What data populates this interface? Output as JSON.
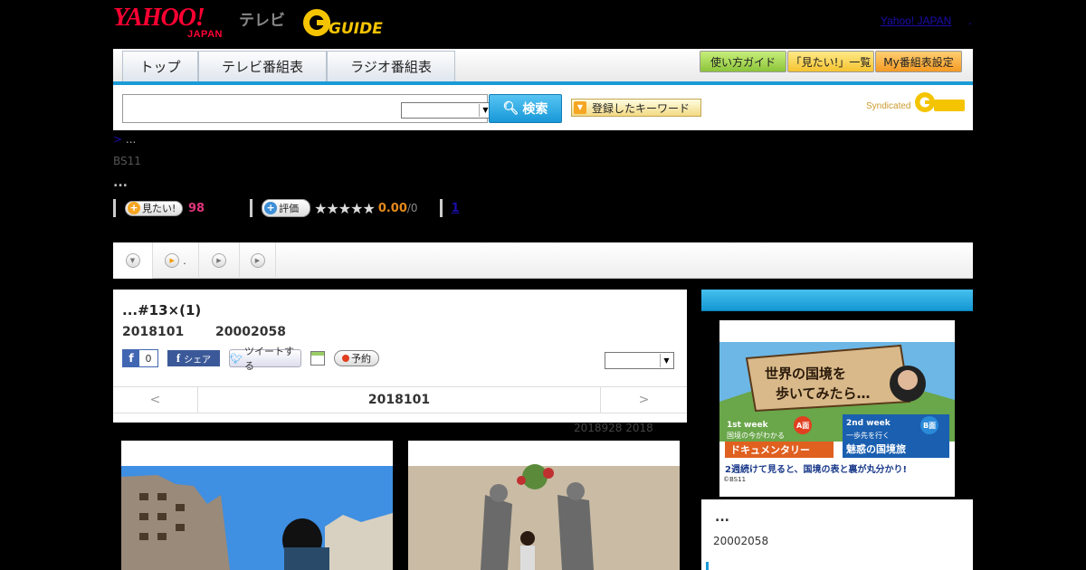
{
  "header": {
    "logo_yahoo_text": "YAHOO!",
    "logo_japan_text": "JAPAN",
    "logo_tv_text": "テレビ",
    "logo_gguide_text": "GUIDE",
    "yahoo_japan_link": "Yahoo! JAPAN",
    "trailing_dot": "."
  },
  "nav": {
    "tabs": [
      {
        "label": "トップ"
      },
      {
        "label": "テレビ番組表"
      },
      {
        "label": "ラジオ番組表"
      }
    ],
    "buttons": [
      {
        "label": "使い方ガイド"
      },
      {
        "label": "「見たい!」一覧"
      },
      {
        "label": "My番組表設定"
      }
    ]
  },
  "search": {
    "input_value": "",
    "select_value": "",
    "button_label": "検索",
    "keyword_button_label": "登録したキーワード",
    "syndicated_label": "Syndicated"
  },
  "breadcrumb": {
    "arrow": ">",
    "text": " ..."
  },
  "channel": "BS11",
  "dots": "...",
  "stats": {
    "mitai_label": "見たい!",
    "mitai_count": "98",
    "hyoka_label": "評価",
    "stars": "★★★★★",
    "score": "0.00",
    "score_den": "/0",
    "link_1": "1"
  },
  "subtabs": [
    {
      "label": ""
    },
    {
      "label": "."
    },
    {
      "label": ""
    },
    {
      "label": ""
    }
  ],
  "program": {
    "title": "...#13×(1)",
    "date": "2018101",
    "time": "20002058",
    "fb_like_count": "0",
    "fb_share_label": "シェア",
    "tweet_label": "ツイートする",
    "yoyaku_label": "予約",
    "select_value": "",
    "pager_prev": "<",
    "pager_mid": "2018101",
    "pager_next": ">"
  },
  "note": "2018928  2018",
  "side": {
    "ad_title_line1": "世界の国境を",
    "ad_title_line2": "歩いてみたら…",
    "ad_week1": "1st week",
    "ad_week1_sub": "国境の今がわかる",
    "ad_doc": "ドキュメンタリー",
    "ad_a": "A面",
    "ad_week2": "2nd week",
    "ad_week2_sub": "一歩先を行く",
    "ad_week2_main": "魅惑の国境旅",
    "ad_b": "B面",
    "ad_bottom": "2週続けて見ると、国境の表と裏が丸分かり!",
    "ad_copy": "©BS11",
    "dots": "...",
    "time": "20002058"
  },
  "colors": {
    "accent_blue": "#1a9bd7",
    "pink": "#e0347a",
    "orange": "#e58a1b",
    "link": "#1a0dab"
  }
}
